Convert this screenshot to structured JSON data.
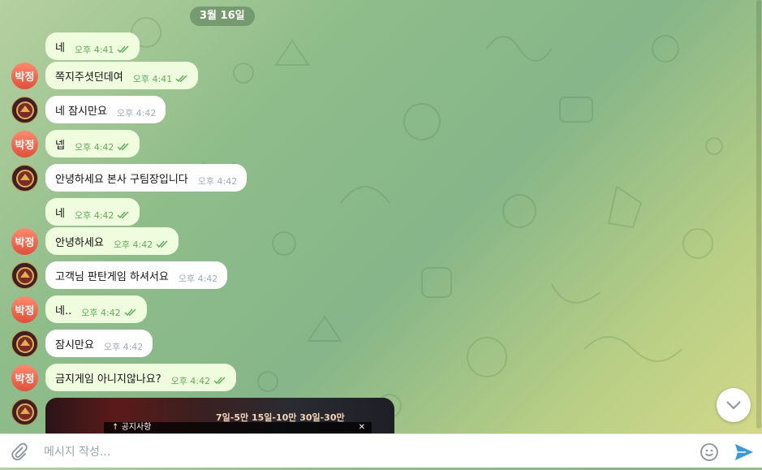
{
  "date_label": "3월 16일",
  "messages": [
    {
      "side": "out",
      "text": "네",
      "time": "오후 4:41",
      "read": true
    },
    {
      "side": "in",
      "avatar": "text",
      "avatar_text": "박정",
      "text": "쪽지주셧던데여",
      "time": "오후 4:41",
      "read": true
    },
    {
      "side": "in",
      "avatar": "logo",
      "text": "네 잠시만요",
      "time": "오후 4:42",
      "read": false
    },
    {
      "side": "in",
      "avatar": "text",
      "avatar_text": "박정",
      "text": "넵",
      "time": "오후 4:42",
      "read": true
    },
    {
      "side": "in",
      "avatar": "logo",
      "text": "안녕하세요 본사 구팀장입니다",
      "time": "오후 4:42",
      "read": false
    },
    {
      "side": "out",
      "text": "네",
      "time": "오후 4:42",
      "read": true
    },
    {
      "side": "in",
      "avatar": "text",
      "avatar_text": "박정",
      "text": "안녕하세요",
      "time": "오후 4:42",
      "read": true
    },
    {
      "side": "in",
      "avatar": "logo",
      "text": "고객님 판탄게임 하셔서요",
      "time": "오후 4:42",
      "read": false
    },
    {
      "side": "in",
      "avatar": "text",
      "avatar_text": "박정",
      "text": "네..",
      "time": "오후 4:42",
      "read": true
    },
    {
      "side": "in",
      "avatar": "logo",
      "text": "잠시만요",
      "time": "오후 4:42",
      "read": false
    },
    {
      "side": "in",
      "avatar": "text",
      "avatar_text": "박정",
      "text": "금지게임 아니지않나요?",
      "time": "오후 4:42",
      "read": true
    }
  ],
  "media_preview": {
    "headline": "7일-5만 15일-10만 30일-30만",
    "notice": "공지사항"
  },
  "input": {
    "placeholder": "메시지 작성..."
  },
  "icons": {
    "attach": "paperclip-icon",
    "emoji": "smiley-icon",
    "send": "send-icon",
    "scroll": "chevron-down-icon"
  },
  "colors": {
    "outgoing_bubble": "#effdde",
    "incoming_bubble": "#ffffff",
    "read_check": "#5fae5a",
    "send_button": "#3a9bdc"
  }
}
